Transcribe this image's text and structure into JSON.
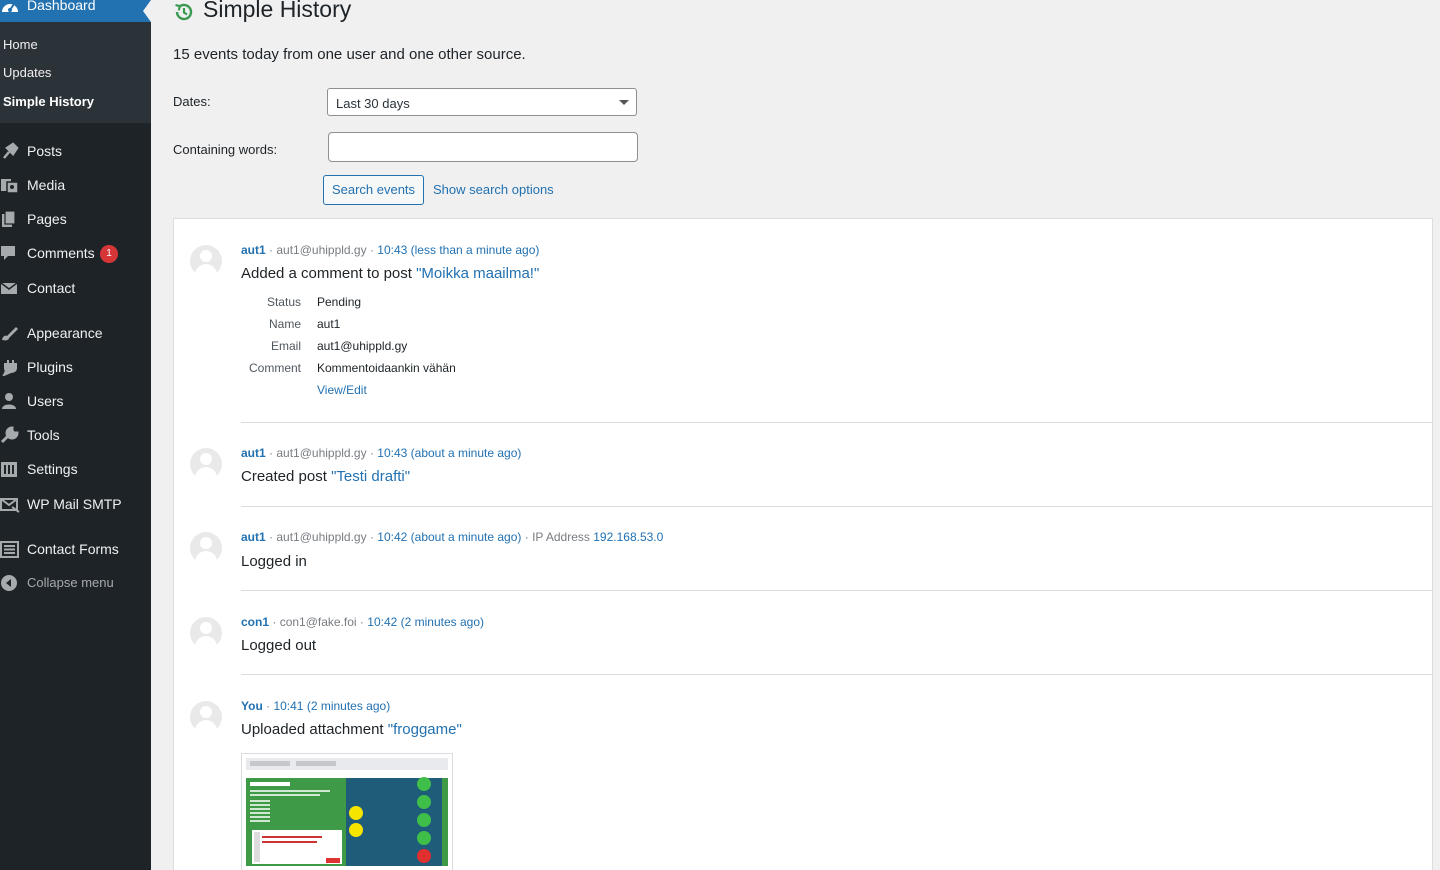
{
  "sidebar": {
    "dashboard": "Dashboard",
    "submenu": [
      "Home",
      "Updates",
      "Simple History"
    ],
    "items": [
      {
        "label": "Posts",
        "icon": "pin-icon"
      },
      {
        "label": "Media",
        "icon": "media-icon"
      },
      {
        "label": "Pages",
        "icon": "pages-icon"
      },
      {
        "label": "Comments",
        "icon": "comment-icon",
        "badge": "1"
      },
      {
        "label": "Contact",
        "icon": "envelope-icon"
      },
      {
        "label": "Appearance",
        "icon": "brush-icon"
      },
      {
        "label": "Plugins",
        "icon": "plugin-icon"
      },
      {
        "label": "Users",
        "icon": "users-icon"
      },
      {
        "label": "Tools",
        "icon": "wrench-icon"
      },
      {
        "label": "Settings",
        "icon": "settings-icon"
      },
      {
        "label": "WP Mail SMTP",
        "icon": "mail-smtp-icon"
      },
      {
        "label": "Contact Forms",
        "icon": "form-icon"
      },
      {
        "label": "Collapse menu",
        "icon": "collapse-icon"
      }
    ]
  },
  "header": {
    "title": "Simple History",
    "summary": "15 events today from one user and one other source."
  },
  "filters": {
    "dates_label": "Dates:",
    "dates_value": "Last 30 days",
    "words_label": "Containing words:",
    "words_value": "",
    "search_button": "Search events",
    "options_link": "Show search options"
  },
  "events": [
    {
      "user": "aut1",
      "email": "aut1@uhippld.gy",
      "time": "10:43 (less than a minute ago)",
      "message_prefix": "Added a comment to post ",
      "message_link": "\"Moikka maailma!\"",
      "details": [
        {
          "key": "Status",
          "value": "Pending"
        },
        {
          "key": "Name",
          "value": "aut1"
        },
        {
          "key": "Email",
          "value": "aut1@uhippld.gy"
        },
        {
          "key": "Comment",
          "value": "Kommentoidaankin vähän"
        }
      ],
      "details_link": "View/Edit"
    },
    {
      "user": "aut1",
      "email": "aut1@uhippld.gy",
      "time": "10:43 (about a minute ago)",
      "message_prefix": "Created post ",
      "message_link": "\"Testi drafti\""
    },
    {
      "user": "aut1",
      "email": "aut1@uhippld.gy",
      "time": "10:42 (about a minute ago)",
      "ip_label": "IP Address",
      "ip_value": "192.168.53.0",
      "message_prefix": "Logged in"
    },
    {
      "user": "con1",
      "email": "con1@fake.foi",
      "time": "10:42 (2 minutes ago)",
      "message_prefix": "Logged out"
    },
    {
      "user": "You",
      "time": "10:41 (2 minutes ago)",
      "message_prefix": "Uploaded attachment ",
      "message_link": "\"froggame\""
    }
  ],
  "separator": " · ",
  "colors": {
    "accent": "#2271b1",
    "sidebar": "#1d2327",
    "badge": "#d63638",
    "history_icon": "#3b9a52"
  }
}
